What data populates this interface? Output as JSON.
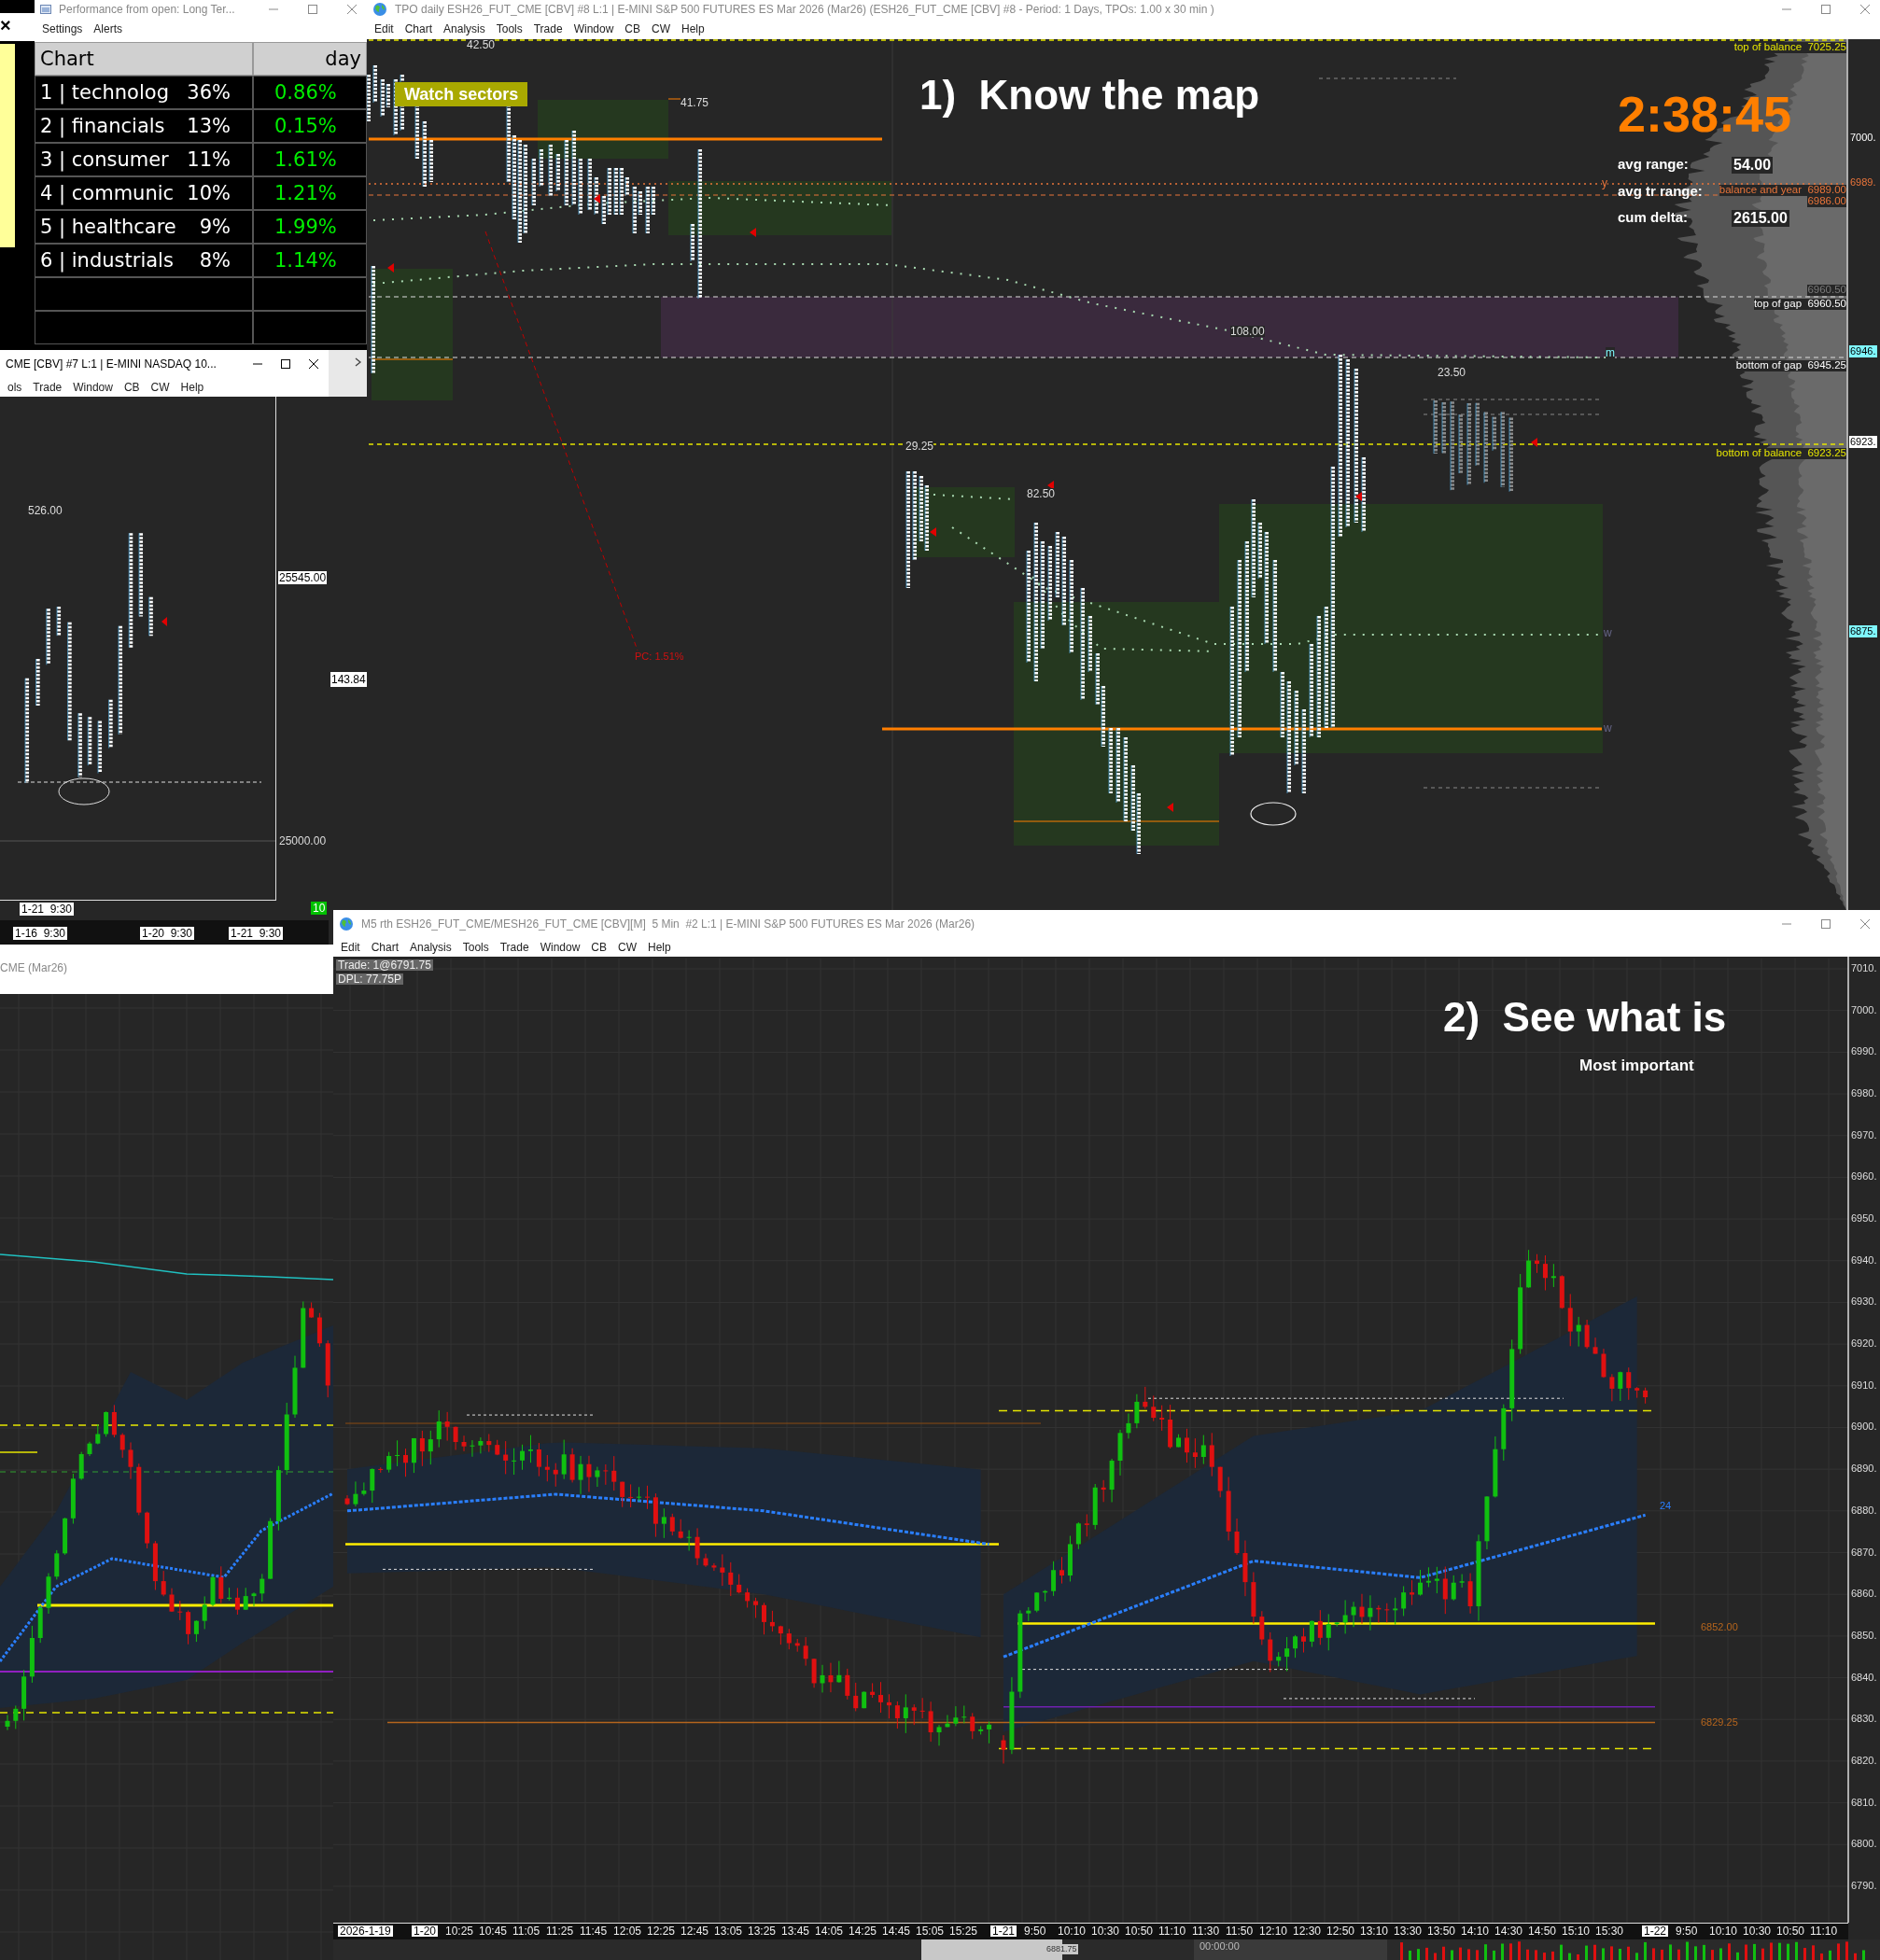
{
  "side_window": {
    "close": "×"
  },
  "performance_window": {
    "title": "Performance from open: Long Ter...",
    "menu": [
      "Settings",
      "Alerts"
    ],
    "columns": [
      "Chart",
      "day"
    ],
    "rows": [
      {
        "name": "1 | technolog",
        "weight": "36%",
        "change": "0.86%"
      },
      {
        "name": "2 | financials",
        "weight": "13%",
        "change": "0.15%"
      },
      {
        "name": "3 | consumer",
        "weight": "11%",
        "change": "1.61%"
      },
      {
        "name": "4 | communic",
        "weight": "10%",
        "change": "1.21%"
      },
      {
        "name": "5 | healthcare",
        "weight": "9%",
        "change": "1.99%"
      },
      {
        "name": "6 | industrials",
        "weight": "8%",
        "change": "1.14%"
      }
    ]
  },
  "tpo_window": {
    "title": "TPO daily ESH26_FUT_CME [CBV] #8 L:1 | E-MINI S&P 500 FUTURES ES Mar 2026 (Mar26) (ESH26_FUT_CME [CBV] #8 - Period: 1 Days, TPOs: 1.00 x 30 min )",
    "menu": [
      "Edit",
      "Chart",
      "Analysis",
      "Tools",
      "Trade",
      "Window",
      "CB",
      "CW",
      "Help"
    ],
    "heading": "1)  Know the map",
    "note": "Watch sectors",
    "timer": "2:38:45",
    "stats": [
      {
        "label": "avg range:",
        "value": "54.00"
      },
      {
        "label": "avg tr range:"
      },
      {
        "label": "cum delta:",
        "value": "2615.00"
      }
    ],
    "levels": [
      {
        "label": "top of balance",
        "price": "7025.25",
        "kind": "balance"
      },
      {
        "label": "balance and year",
        "price": "6989.00",
        "kind": "year"
      },
      {
        "price": "6986.00",
        "kind": "year"
      },
      {
        "price": "6960.50",
        "kind": "faded"
      },
      {
        "label": "top of gap",
        "price": "6960.50",
        "kind": "gap"
      },
      {
        "label": "bottom of gap",
        "price": "6945.25",
        "kind": "gap"
      },
      {
        "label": "bottom of balance",
        "price": "6923.25",
        "kind": "balance"
      }
    ],
    "chart_labels": [
      "42.50",
      "41.75",
      "108.00",
      "23.50",
      "29.25",
      "82.50",
      "PC: 1.51%",
      "y",
      "m",
      "w",
      "w"
    ],
    "price_tags": [
      {
        "text": "7000.",
        "kind": "plain"
      },
      {
        "text": "6989.",
        "kind": "year"
      },
      {
        "text": "6946.",
        "kind": "highlight"
      },
      {
        "text": "6923.",
        "kind": "last"
      },
      {
        "text": "6875.",
        "kind": "highlight"
      }
    ]
  },
  "nasdaq_window": {
    "title": "CME [CBV] #7 L:1 | E-MINI NASDAQ 10...",
    "menu": [
      "ols",
      "Trade",
      "Window",
      "CB",
      "CW",
      "Help"
    ],
    "chart_label": "526.00",
    "price_tags": [
      "25545.00",
      "25000.00"
    ],
    "side_tag": "143.84",
    "cursor_date": "1-21  9:30",
    "count": "10",
    "dates": [
      "1-16  9:30",
      "1-20  9:30",
      "1-21  9:30"
    ]
  },
  "left_window": {
    "title": "CME (Mar26)"
  },
  "m5_window": {
    "title": "M5 rth ESH26_FUT_CME/MESH26_FUT_CME [CBV][M]  5 Min  #2 L:1 | E-MINI S&P 500 FUTURES ES Mar 2026 (Mar26)",
    "menu": [
      "Edit",
      "Chart",
      "Analysis",
      "Tools",
      "Trade",
      "Window",
      "CB",
      "CW",
      "Help"
    ],
    "info": [
      "Trade: 1@6791.75",
      "DPL: 77.75P"
    ],
    "heading": "2)  See what is",
    "subheading": "Most important",
    "y_axis": [
      "7010.",
      "7000.",
      "6990.",
      "6980.",
      "6970.",
      "6960.",
      "6950.",
      "6940.",
      "6930.",
      "6920.",
      "6910.",
      "6900.",
      "6890.",
      "6880.",
      "6870.",
      "6860.",
      "6850.",
      "6840.",
      "6830.",
      "6820.",
      "6810.",
      "6800.",
      "6790."
    ],
    "level_labels": [
      "6852.00",
      "6829.25",
      "24"
    ],
    "x_axis": [
      {
        "text": "2026-1-19",
        "kind": "date"
      },
      {
        "text": "1-20",
        "kind": "date"
      },
      {
        "text": "10:25",
        "kind": "time"
      },
      {
        "text": "10:45",
        "kind": "time"
      },
      {
        "text": "11:05",
        "kind": "time"
      },
      {
        "text": "11:25",
        "kind": "time"
      },
      {
        "text": "11:45",
        "kind": "time"
      },
      {
        "text": "12:05",
        "kind": "time"
      },
      {
        "text": "12:25",
        "kind": "time"
      },
      {
        "text": "12:45",
        "kind": "time"
      },
      {
        "text": "13:05",
        "kind": "time"
      },
      {
        "text": "13:25",
        "kind": "time"
      },
      {
        "text": "13:45",
        "kind": "time"
      },
      {
        "text": "14:05",
        "kind": "time"
      },
      {
        "text": "14:25",
        "kind": "time"
      },
      {
        "text": "14:45",
        "kind": "time"
      },
      {
        "text": "15:05",
        "kind": "time"
      },
      {
        "text": "15:25",
        "kind": "time"
      },
      {
        "text": "1-21",
        "kind": "date"
      },
      {
        "text": "9:50",
        "kind": "time"
      },
      {
        "text": "10:10",
        "kind": "time"
      },
      {
        "text": "10:30",
        "kind": "time"
      },
      {
        "text": "10:50",
        "kind": "time"
      },
      {
        "text": "11:10",
        "kind": "time"
      },
      {
        "text": "11:30",
        "kind": "time"
      },
      {
        "text": "11:50",
        "kind": "time"
      },
      {
        "text": "12:10",
        "kind": "time"
      },
      {
        "text": "12:30",
        "kind": "time"
      },
      {
        "text": "12:50",
        "kind": "time"
      },
      {
        "text": "13:10",
        "kind": "time"
      },
      {
        "text": "13:30",
        "kind": "time"
      },
      {
        "text": "13:50",
        "kind": "time"
      },
      {
        "text": "14:10",
        "kind": "time"
      },
      {
        "text": "14:30",
        "kind": "time"
      },
      {
        "text": "14:50",
        "kind": "time"
      },
      {
        "text": "15:10",
        "kind": "time"
      },
      {
        "text": "15:30",
        "kind": "time"
      },
      {
        "text": "1-22",
        "kind": "date"
      },
      {
        "text": "9:50",
        "kind": "time"
      },
      {
        "text": "10:10",
        "kind": "time"
      },
      {
        "text": "10:30",
        "kind": "time"
      },
      {
        "text": "10:50",
        "kind": "time"
      },
      {
        "text": "11:10",
        "kind": "time"
      }
    ],
    "quote": "6881.75",
    "clock": "00:00:00"
  }
}
